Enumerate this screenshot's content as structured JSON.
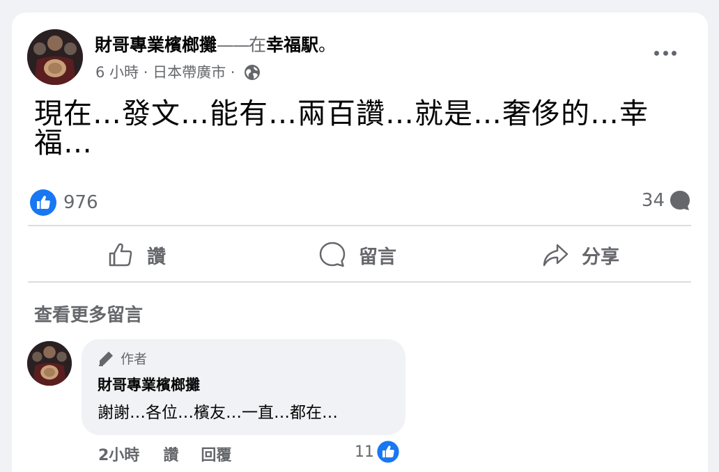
{
  "post": {
    "author_name": "財哥專業檳榔攤",
    "dash": "——",
    "with_word": "在",
    "location": "幸福駅",
    "end_punct": "。",
    "time": "6 小時",
    "sep": " · ",
    "place": "日本帶廣市",
    "privacy_icon": "globe-icon",
    "text": "現在…發文…能有…兩百讚…就是…奢侈的…幸福…",
    "like_count": "976",
    "comment_count": "34"
  },
  "actions": {
    "like_label": "讚",
    "comment_label": "留言",
    "share_label": "分享"
  },
  "comments_section": {
    "view_more": "查看更多留言"
  },
  "comment": {
    "badge": "作者",
    "author_name": "財哥專業檳榔攤",
    "text": "謝謝…各位…檳友…一直…都在…",
    "time": "2小時",
    "like_label": "讚",
    "reply_label": "回覆",
    "like_count": "11"
  },
  "colors": {
    "brand_blue": "#1877f2",
    "secondary_text": "#65676b",
    "background": "#f0f2f5",
    "card": "#ffffff",
    "divider": "#dadde1"
  }
}
